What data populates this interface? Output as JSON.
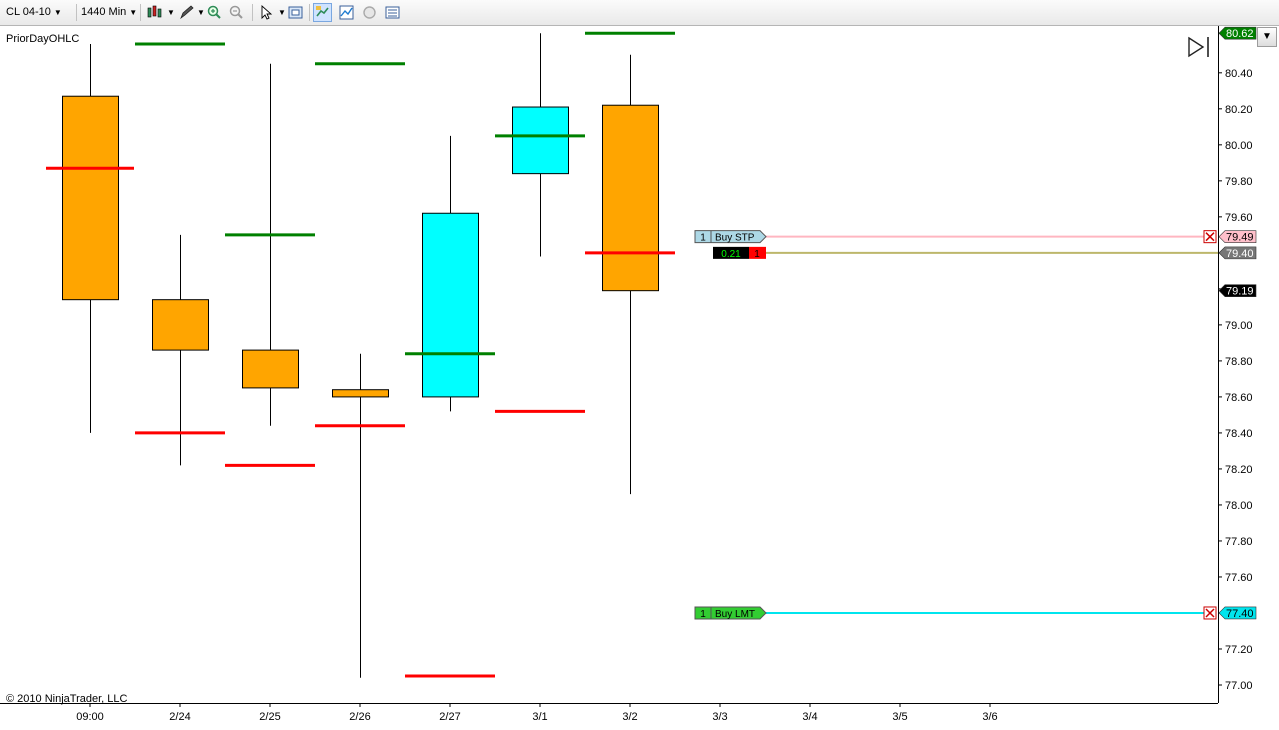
{
  "toolbar": {
    "instrument": "CL 04-10",
    "interval": "1440 Min",
    "icons": [
      "candlestick-icon",
      "pencil-icon",
      "zoom-in-icon",
      "zoom-out-icon",
      "pointer-icon",
      "properties-icon",
      "chart-trader-icon",
      "indicators-icon",
      "strategies-icon",
      "data-box-icon"
    ]
  },
  "indicator_label": "PriorDayOHLC",
  "copyright": "© 2010 NinjaTrader, LLC",
  "colors": {
    "up": "#00ffff",
    "down": "#ffa500",
    "prior_high": "#008000",
    "prior_low": "#ff0000",
    "stop_line": "#ffb6c1",
    "position_line": "#bdb76b",
    "limit_line": "#00e5ee"
  },
  "chart_data": {
    "type": "candlestick",
    "ylim": [
      76.9,
      80.66
    ],
    "y_ticks": [
      "77.00",
      "77.20",
      "77.40",
      "77.60",
      "77.80",
      "78.00",
      "78.20",
      "78.40",
      "78.60",
      "78.80",
      "79.00",
      "79.20",
      "79.40",
      "79.60",
      "79.80",
      "80.00",
      "80.20",
      "80.40"
    ],
    "x_labels": [
      "09:00",
      "2/24",
      "2/25",
      "2/26",
      "2/27",
      "3/1",
      "3/2",
      "3/3",
      "3/4",
      "3/5",
      "3/6"
    ],
    "candles": [
      {
        "open": 80.27,
        "high": 80.56,
        "low": 78.4,
        "close": 79.14
      },
      {
        "open": 79.14,
        "high": 79.5,
        "low": 78.22,
        "close": 78.86
      },
      {
        "open": 78.86,
        "high": 80.45,
        "low": 78.44,
        "close": 78.65
      },
      {
        "open": 78.64,
        "high": 78.84,
        "low": 77.04,
        "close": 78.6
      },
      {
        "open": 78.6,
        "high": 80.05,
        "low": 78.52,
        "close": 79.62
      },
      {
        "open": 79.84,
        "high": 80.62,
        "low": 79.38,
        "close": 80.21
      },
      {
        "open": 80.22,
        "high": 80.5,
        "low": 78.06,
        "close": 79.19
      }
    ],
    "prior_high": [
      80.56,
      79.5,
      80.45,
      78.84,
      80.05,
      80.62
    ],
    "prior_low": [
      78.4,
      78.22,
      78.44,
      77.05,
      78.52,
      79.4
    ],
    "prior_close_red": 79.87,
    "price_markers": [
      {
        "label": "80.62",
        "value": 80.62,
        "bg": "#008000",
        "fg": "#ffffff"
      },
      {
        "label": "79.49",
        "value": 79.49,
        "bg": "#ffc0cb",
        "fg": "#000000"
      },
      {
        "label": "79.40",
        "value": 79.4,
        "bg": "#777777",
        "fg": "#ffffff"
      },
      {
        "label": "79.19",
        "value": 79.19,
        "bg": "#000000",
        "fg": "#ffffff"
      },
      {
        "label": "77.40",
        "value": 77.4,
        "bg": "#00e5ee",
        "fg": "#000000"
      }
    ],
    "orders": [
      {
        "qty": "1",
        "label": "Buy STP",
        "price": 79.49,
        "color": "#add8e6",
        "line": "#ffb6c1"
      },
      {
        "qty": "1",
        "label": "Buy LMT",
        "price": 77.4,
        "color": "#32cd32",
        "line": "#00e5ee"
      }
    ],
    "position": {
      "pnl": "0.21",
      "qty": "1",
      "price": 79.4
    }
  }
}
